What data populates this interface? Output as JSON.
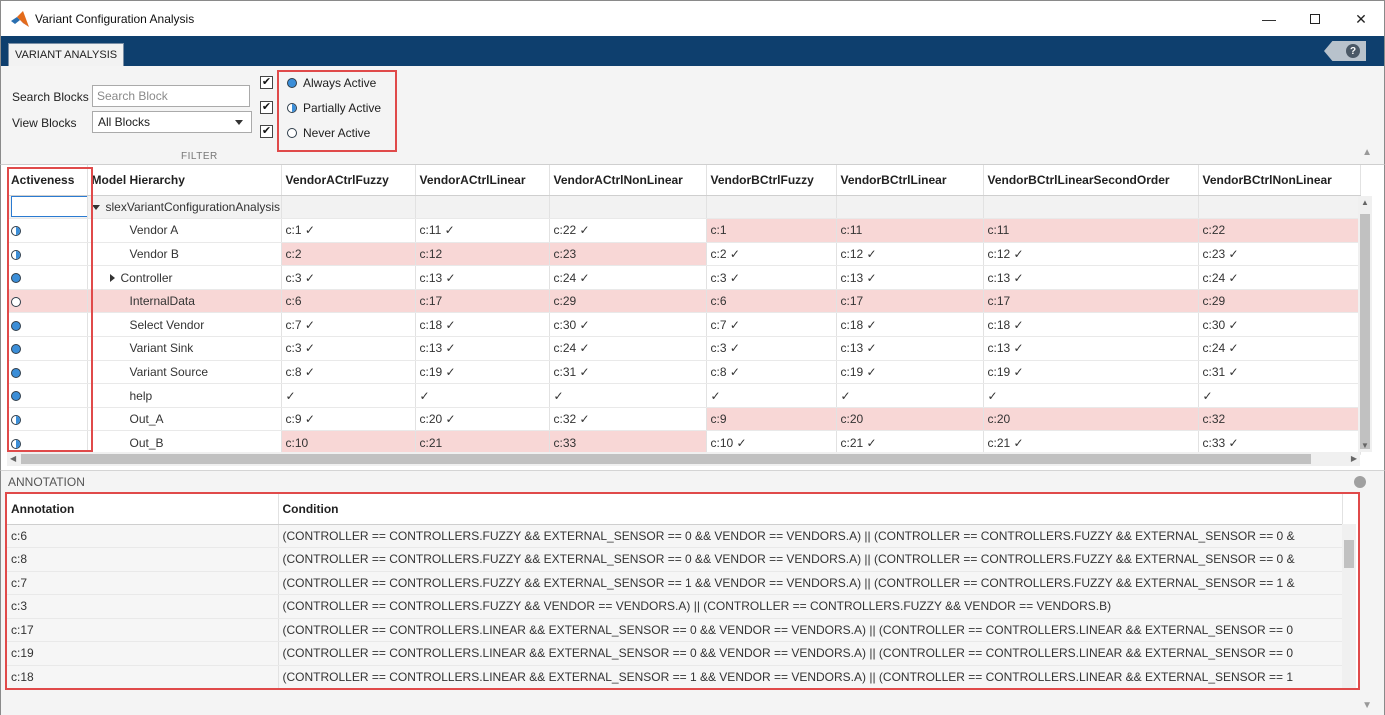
{
  "window": {
    "title": "Variant Configuration Analysis"
  },
  "toolstrip": {
    "tab_label": "VARIANT ANALYSIS",
    "help_label": "?"
  },
  "filter": {
    "search_label": "Search Blocks",
    "search_placeholder": "Search Block",
    "search_value": "",
    "view_label": "View Blocks",
    "view_value": "All Blocks",
    "checkbox_mark": "✔",
    "radio_always": "Always Active",
    "radio_partial": "Partially Active",
    "radio_never": "Never Active",
    "caption": "FILTER"
  },
  "table": {
    "headers": [
      "Activeness",
      "Model Hierarchy",
      "VendorACtrlFuzzy",
      "VendorACtrlLinear",
      "VendorACtrlNonLinear",
      "VendorBCtrlFuzzy",
      "VendorBCtrlLinear",
      "VendorBCtrlLinearSecondOrder",
      "VendorBCtrlNonLinear"
    ],
    "root_label": "slexVariantConfigurationAnalysis",
    "rows": [
      {
        "state": "partial",
        "name": "Vendor A",
        "cells": [
          "c:1 ✓",
          "c:11 ✓",
          "c:22 ✓",
          "c:1",
          "c:11",
          "c:11",
          "c:22"
        ]
      },
      {
        "state": "partial",
        "name": "Vendor B",
        "cells": [
          "c:2",
          "c:12",
          "c:23",
          "c:2 ✓",
          "c:12 ✓",
          "c:12 ✓",
          "c:23 ✓"
        ]
      },
      {
        "state": "always",
        "name": "Controller",
        "cells": [
          "c:3 ✓",
          "c:13 ✓",
          "c:24 ✓",
          "c:3 ✓",
          "c:13 ✓",
          "c:13 ✓",
          "c:24 ✓"
        ]
      },
      {
        "state": "never",
        "name": "InternalData",
        "cells": [
          "c:6",
          "c:17",
          "c:29",
          "c:6",
          "c:17",
          "c:17",
          "c:29"
        ]
      },
      {
        "state": "always",
        "name": "Select Vendor",
        "cells": [
          "c:7 ✓",
          "c:18 ✓",
          "c:30 ✓",
          "c:7 ✓",
          "c:18 ✓",
          "c:18 ✓",
          "c:30 ✓"
        ]
      },
      {
        "state": "always",
        "name": "Variant Sink",
        "cells": [
          "c:3 ✓",
          "c:13 ✓",
          "c:24 ✓",
          "c:3 ✓",
          "c:13 ✓",
          "c:13 ✓",
          "c:24 ✓"
        ]
      },
      {
        "state": "always",
        "name": "Variant Source",
        "cells": [
          "c:8 ✓",
          "c:19 ✓",
          "c:31 ✓",
          "c:8 ✓",
          "c:19 ✓",
          "c:19 ✓",
          "c:31 ✓"
        ]
      },
      {
        "state": "always",
        "name": "help",
        "cells": [
          "✓",
          "✓",
          "✓",
          "✓",
          "✓",
          "✓",
          "✓"
        ]
      },
      {
        "state": "partial",
        "name": "Out_A",
        "cells": [
          "c:9 ✓",
          "c:20 ✓",
          "c:32 ✓",
          "c:9",
          "c:20",
          "c:20",
          "c:32"
        ]
      },
      {
        "state": "partial",
        "name": "Out_B",
        "cells": [
          "c:10",
          "c:21",
          "c:33",
          "c:10 ✓",
          "c:21 ✓",
          "c:21 ✓",
          "c:33 ✓"
        ]
      }
    ]
  },
  "annotation": {
    "section_label": "ANNOTATION",
    "headers": [
      "Annotation",
      "Condition"
    ],
    "rows": [
      {
        "id": "c:6",
        "condition": "(CONTROLLER == CONTROLLERS.FUZZY && EXTERNAL_SENSOR == 0 && VENDOR == VENDORS.A) || (CONTROLLER == CONTROLLERS.FUZZY && EXTERNAL_SENSOR == 0 &"
      },
      {
        "id": "c:8",
        "condition": "(CONTROLLER == CONTROLLERS.FUZZY && EXTERNAL_SENSOR == 0 && VENDOR == VENDORS.A) || (CONTROLLER == CONTROLLERS.FUZZY && EXTERNAL_SENSOR == 0 &"
      },
      {
        "id": "c:7",
        "condition": "(CONTROLLER == CONTROLLERS.FUZZY && EXTERNAL_SENSOR == 1 && VENDOR == VENDORS.A) || (CONTROLLER == CONTROLLERS.FUZZY && EXTERNAL_SENSOR == 1 &"
      },
      {
        "id": "c:3",
        "condition": "(CONTROLLER == CONTROLLERS.FUZZY && VENDOR == VENDORS.A) || (CONTROLLER == CONTROLLERS.FUZZY && VENDOR == VENDORS.B)"
      },
      {
        "id": "c:17",
        "condition": "(CONTROLLER == CONTROLLERS.LINEAR && EXTERNAL_SENSOR == 0 && VENDOR == VENDORS.A) || (CONTROLLER == CONTROLLERS.LINEAR && EXTERNAL_SENSOR == 0"
      },
      {
        "id": "c:19",
        "condition": "(CONTROLLER == CONTROLLERS.LINEAR && EXTERNAL_SENSOR == 0 && VENDOR == VENDORS.A) || (CONTROLLER == CONTROLLERS.LINEAR && EXTERNAL_SENSOR == 0"
      },
      {
        "id": "c:18",
        "condition": "(CONTROLLER == CONTROLLERS.LINEAR && EXTERNAL_SENSOR == 1 && VENDOR == VENDORS.A) || (CONTROLLER == CONTROLLERS.LINEAR && EXTERNAL_SENSOR == 1"
      }
    ]
  },
  "colors": {
    "accent": "#0e3f6e",
    "active_blue": "#3b8ed8",
    "highlight": "#f8d7d6",
    "callout": "#e04a4a"
  }
}
